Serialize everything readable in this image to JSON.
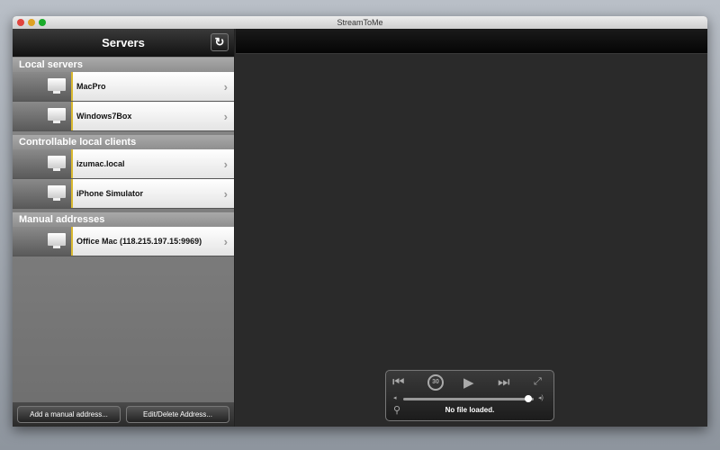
{
  "window": {
    "title": "StreamToMe"
  },
  "sidebar": {
    "title": "Servers",
    "sections": [
      {
        "label": "Local servers",
        "items": [
          {
            "label": "MacPro"
          },
          {
            "label": "Windows7Box"
          }
        ]
      },
      {
        "label": "Controllable local clients",
        "items": [
          {
            "label": "izumac.local"
          },
          {
            "label": "iPhone Simulator"
          }
        ]
      },
      {
        "label": "Manual addresses",
        "items": [
          {
            "label": "Office Mac (118.215.197.15:9969)"
          }
        ]
      }
    ],
    "add_button": "Add a manual address...",
    "edit_button": "Edit/Delete Address..."
  },
  "player": {
    "status": "No file loaded.",
    "skip_back_seconds": "30",
    "volume": 0.96
  }
}
